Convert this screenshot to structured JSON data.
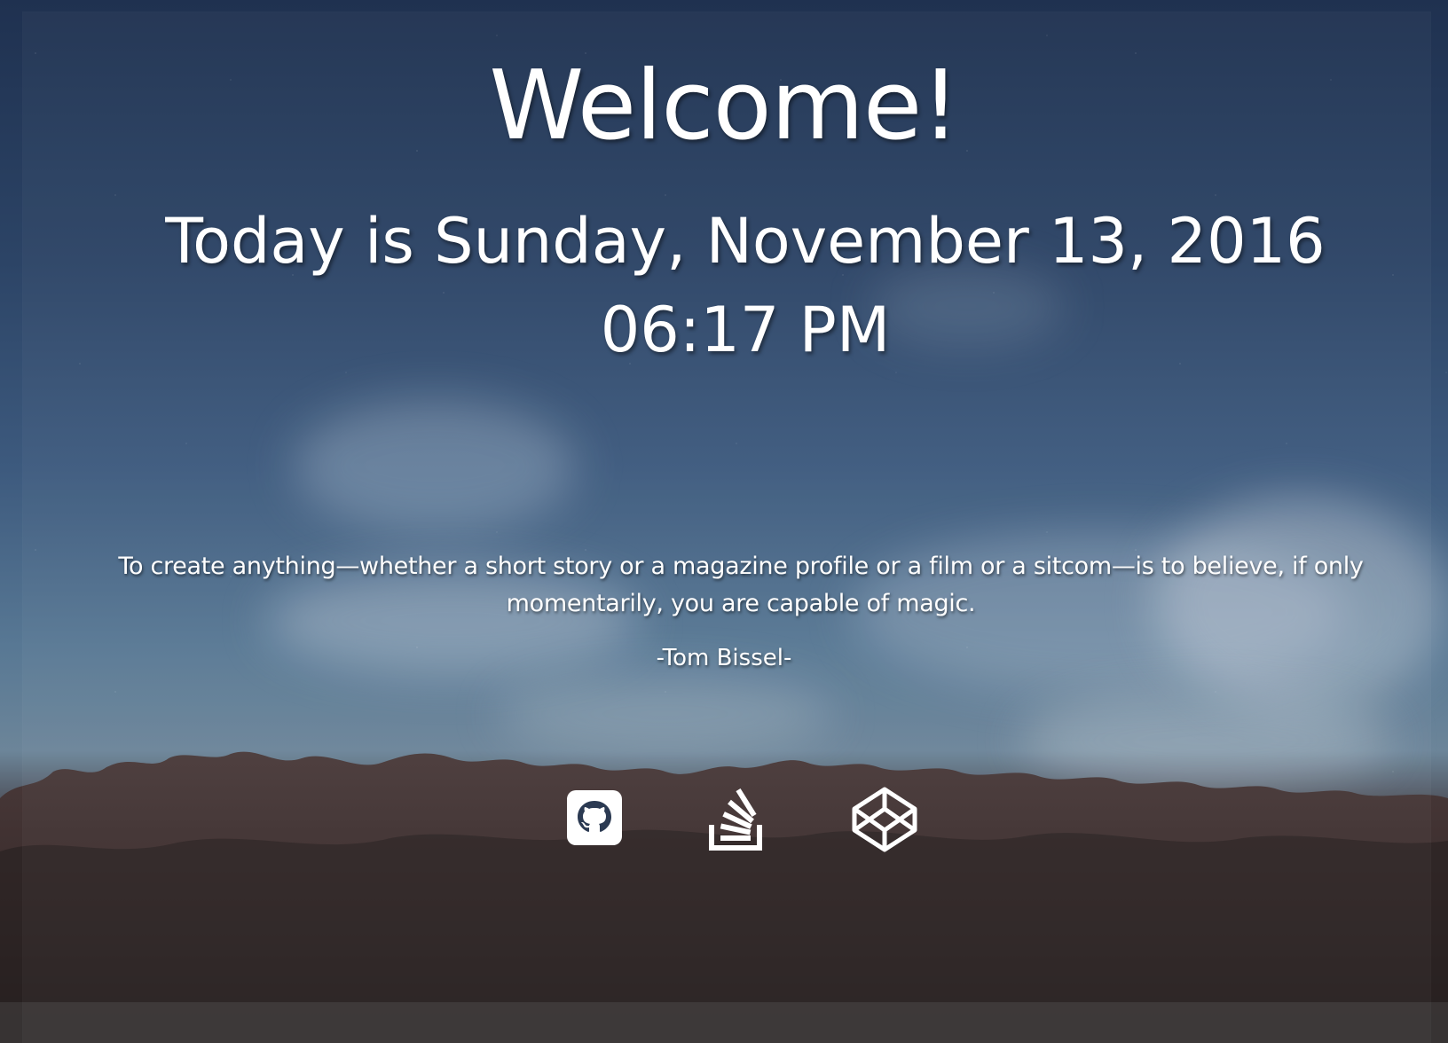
{
  "heading": {
    "welcome": "Welcome!",
    "date_line": "Today is Sunday, November 13, 2016 06:17 PM"
  },
  "quote": {
    "text": "To create anything—whether a short story or a magazine profile or a film or a sitcom—is to believe, if only momentarily, you are capable of magic.",
    "author": "-Tom Bissel-"
  },
  "social": [
    {
      "name": "github",
      "icon": "github-icon"
    },
    {
      "name": "stack overflow",
      "icon": "stackoverflow-icon"
    },
    {
      "name": "codepen",
      "icon": "codepen-icon"
    }
  ],
  "colors": {
    "text": "#ffffff",
    "sky_top": "#1f3150",
    "sky_mid": "#587894",
    "forest": "#2c2424"
  }
}
